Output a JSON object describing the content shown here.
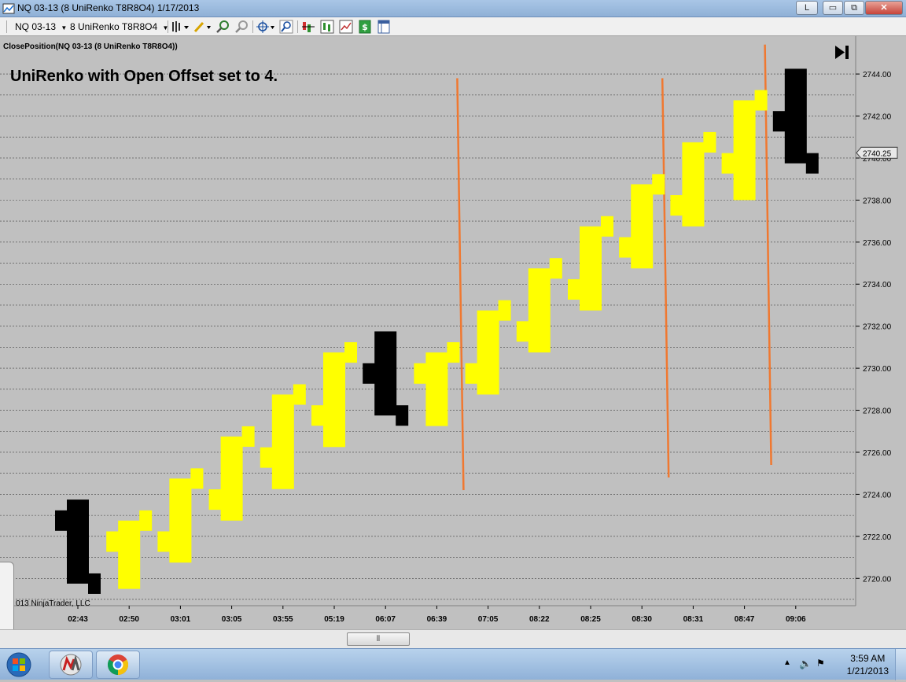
{
  "window": {
    "title": "NQ 03-13 (8 UniRenko T8R8O4)  1/17/2013",
    "buttons": {
      "layout": "L",
      "minimize": "▭",
      "restore": "⧉",
      "close": "✕"
    }
  },
  "toolbar": {
    "instrument": "NQ 03-13",
    "period": "8 UniRenko T8R8O4",
    "icons": [
      "bar-type-icon",
      "drawing-pencil-icon",
      "zoom-in-icon",
      "zoom-out-icon",
      "crosshair-icon",
      "magnify-icon",
      "indicators-icon",
      "strategies-icon",
      "chart-properties-icon",
      "dollar-icon",
      "data-box-icon"
    ]
  },
  "chart": {
    "indicator_label": "ClosePosition(NQ 03-13 (8 UniRenko T8R8O4))",
    "annotation": "UniRenko with Open Offset set to 4.",
    "copyright": "013 NinjaTrader, LLC",
    "go_to_end_icon": "go-to-end-icon",
    "current_price_label": "2740.25",
    "colors": {
      "background": "#c0c0c0",
      "up": "#ffff00",
      "down": "#000000",
      "vline": "#f07830",
      "grid": "#404040"
    }
  },
  "chart_data": {
    "type": "bar",
    "ylim": [
      2718.7,
      2745.8
    ],
    "yticks": [
      "2744.00",
      "2742.00",
      "2740.00",
      "2738.00",
      "2736.00",
      "2734.00",
      "2732.00",
      "2730.00",
      "2728.00",
      "2726.00",
      "2724.00",
      "2722.00",
      "2720.00"
    ],
    "ytick_values": [
      2744,
      2742,
      2740,
      2738,
      2736,
      2734,
      2732,
      2730,
      2728,
      2726,
      2724,
      2722,
      2720
    ],
    "current_price": 2740.25,
    "categories": [
      "02:43",
      "02:50",
      "03:01",
      "03:05",
      "03:55",
      "05:19",
      "06:07",
      "06:39",
      "07:05",
      "08:22",
      "08:25",
      "08:30",
      "08:31",
      "08:47",
      "09:06"
    ],
    "bars": [
      {
        "time": "02:43",
        "open": 2722.75,
        "high": 2723.75,
        "low": 2719.75,
        "close": 2719.75,
        "direction": "down"
      },
      {
        "time": "02:50",
        "open": 2721.75,
        "high": 2722.75,
        "low": 2719.5,
        "close": 2722.75,
        "direction": "up"
      },
      {
        "time": "03:01",
        "open": 2721.75,
        "high": 2724.75,
        "low": 2720.75,
        "close": 2724.75,
        "direction": "up"
      },
      {
        "time": "03:05",
        "open": 2723.75,
        "high": 2726.75,
        "low": 2722.75,
        "close": 2726.75,
        "direction": "up"
      },
      {
        "time": "03:55",
        "open": 2725.75,
        "high": 2728.75,
        "low": 2724.25,
        "close": 2728.75,
        "direction": "up"
      },
      {
        "time": "05:19",
        "open": 2727.75,
        "high": 2730.75,
        "low": 2726.25,
        "close": 2730.75,
        "direction": "up"
      },
      {
        "time": "06:07",
        "open": 2729.75,
        "high": 2731.75,
        "low": 2727.75,
        "close": 2727.75,
        "direction": "down"
      },
      {
        "time": "06:39",
        "open": 2729.75,
        "high": 2730.75,
        "low": 2727.25,
        "close": 2730.75,
        "direction": "up"
      },
      {
        "time": "07:05",
        "open": 2729.75,
        "high": 2732.75,
        "low": 2728.75,
        "close": 2732.75,
        "direction": "up"
      },
      {
        "time": "08:22",
        "open": 2731.75,
        "high": 2734.75,
        "low": 2730.75,
        "close": 2734.75,
        "direction": "up"
      },
      {
        "time": "08:25",
        "open": 2733.75,
        "high": 2736.75,
        "low": 2732.75,
        "close": 2736.75,
        "direction": "up"
      },
      {
        "time": "08:30",
        "open": 2735.75,
        "high": 2738.75,
        "low": 2734.75,
        "close": 2738.75,
        "direction": "up"
      },
      {
        "time": "08:31",
        "open": 2737.75,
        "high": 2740.75,
        "low": 2736.75,
        "close": 2740.75,
        "direction": "up"
      },
      {
        "time": "08:47",
        "open": 2739.75,
        "high": 2742.75,
        "low": 2738.0,
        "close": 2742.75,
        "direction": "up"
      },
      {
        "time": "09:06",
        "open": 2741.75,
        "high": 2744.25,
        "low": 2739.75,
        "close": 2739.75,
        "direction": "down"
      }
    ],
    "vertical_lines": [
      {
        "after": "06:39",
        "top": 2743.8,
        "bottom": 2724.2
      },
      {
        "after": "08:30",
        "top": 2743.8,
        "bottom": 2724.8
      },
      {
        "after": "08:47",
        "top": 2745.4,
        "bottom": 2725.4
      }
    ]
  },
  "taskbar": {
    "apps": [
      "ninjatrader-icon",
      "chrome-icon"
    ],
    "time": "3:59 AM",
    "date": "1/21/2013"
  }
}
